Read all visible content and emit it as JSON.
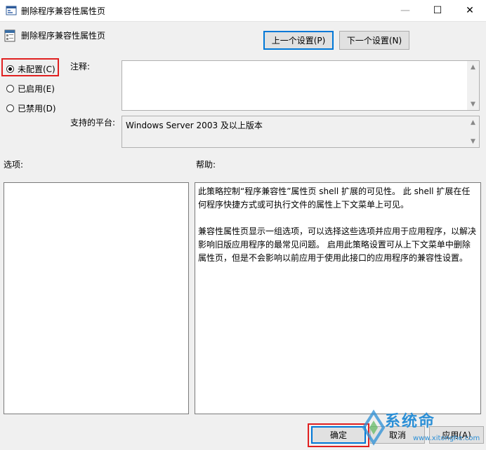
{
  "window": {
    "title": "删除程序兼容性属性页",
    "minimize_glyph": "—",
    "maximize_glyph": "☐",
    "close_glyph": "✕"
  },
  "header": {
    "title": "删除程序兼容性属性页"
  },
  "nav": {
    "prev_label": "上一个设置(P)",
    "next_label": "下一个设置(N)"
  },
  "state_options": [
    {
      "label": "未配置(C)",
      "checked": true
    },
    {
      "label": "已启用(E)",
      "checked": false
    },
    {
      "label": "已禁用(D)",
      "checked": false
    }
  ],
  "comment": {
    "label": "注释:",
    "value": ""
  },
  "platform": {
    "label": "支持的平台:",
    "value": "Windows Server 2003 及以上版本"
  },
  "options": {
    "label": "选项:"
  },
  "help": {
    "label": "帮助:",
    "paragraphs": [
      "此策略控制“程序兼容性”属性页 shell 扩展的可见性。 此 shell 扩展在任何程序快捷方式或可执行文件的属性上下文菜单上可见。",
      "兼容性属性页显示一组选项，可以选择这些选项并应用于应用程序，以解决影响旧版应用程序的最常见问题。 启用此策略设置可从上下文菜单中删除属性页，但是不会影响以前应用于使用此接口的应用程序的兼容性设置。"
    ]
  },
  "footer": {
    "ok_label": "确定",
    "cancel_label": "取消",
    "apply_label": "应用(A)"
  },
  "watermark": {
    "text": "系统命",
    "url": "www.xitonghe.com"
  },
  "icons": {
    "app": "policy-page-icon",
    "scroll_up": "scroll-up-icon",
    "scroll_down": "scroll-down-icon"
  },
  "colors": {
    "highlight_box": "#e02020",
    "focus_border": "#0078d7",
    "watermark": "#2b8fd6"
  }
}
